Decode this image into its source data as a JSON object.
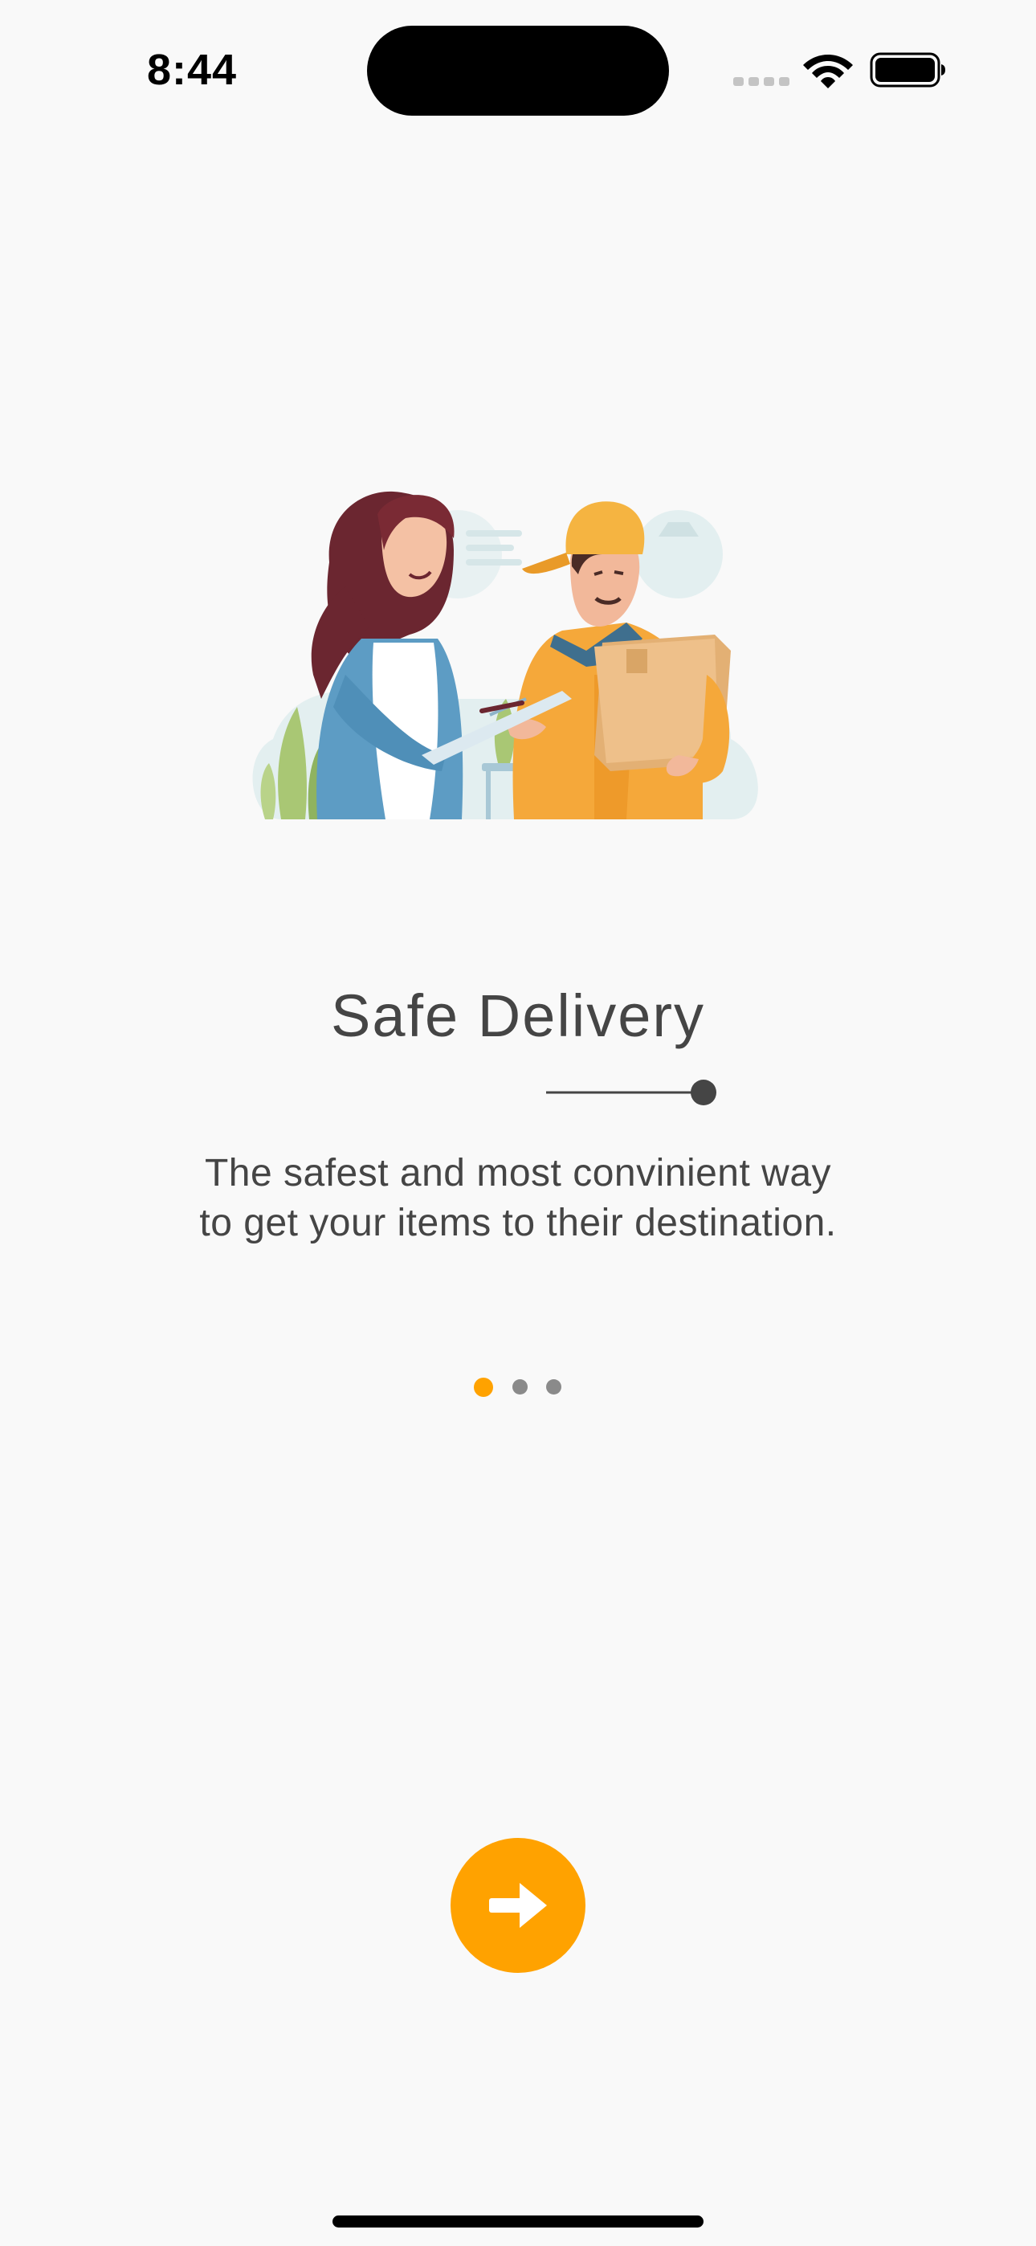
{
  "status_bar": {
    "time": "8:44",
    "icons": [
      "signal-icon",
      "wifi-icon",
      "battery-icon"
    ]
  },
  "onboarding": {
    "illustration": "delivery-courier-illustration",
    "title": "Safe Delivery",
    "description": "The safest and most convinient way to get your items to their destination.",
    "page_indicator": {
      "current": 1,
      "total": 3
    },
    "next_button_icon": "arrow-right-icon"
  },
  "colors": {
    "background": "#f9f9f9",
    "accent": "#ffa200",
    "text": "#454545",
    "inactive_dot": "#8a8a8a"
  }
}
